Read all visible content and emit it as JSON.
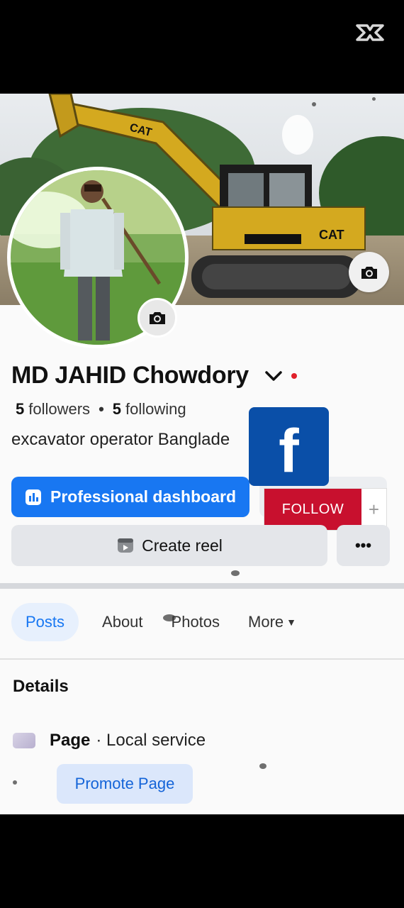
{
  "profile": {
    "name": "MD JAHID Chowdory",
    "followers_count": "5",
    "followers_label": "followers",
    "following_count": "5",
    "following_label": "following",
    "separator": "•",
    "bio": "excavator operator Banglade"
  },
  "overlay": {
    "fb_logo_letter": "f",
    "follow_label": "FOLLOW",
    "follow_plus": "+"
  },
  "actions": {
    "dashboard_label": "Professional dashboard",
    "reel_label": "Create reel",
    "more_label": "•••"
  },
  "tabs": [
    {
      "label": "Posts",
      "active": true
    },
    {
      "label": "About"
    },
    {
      "label": "Photos"
    },
    {
      "label": "More"
    }
  ],
  "details": {
    "heading": "Details",
    "page_type_bold": "Page",
    "page_type_rest": "· Local service",
    "promote_label": "Promote Page"
  },
  "icons": {
    "capcut": "capcut-logo-icon",
    "cover_camera": "camera-icon",
    "avatar_camera": "camera-icon",
    "chevron": "chevron-down-icon",
    "dashboard": "bar-chart-icon",
    "reel": "reel-icon",
    "page": "page-icon"
  },
  "colors": {
    "primary": "#1877f2",
    "follow_red": "#c8102e",
    "fb_blue": "#0a4fa8",
    "status_dot": "#e0202a"
  }
}
